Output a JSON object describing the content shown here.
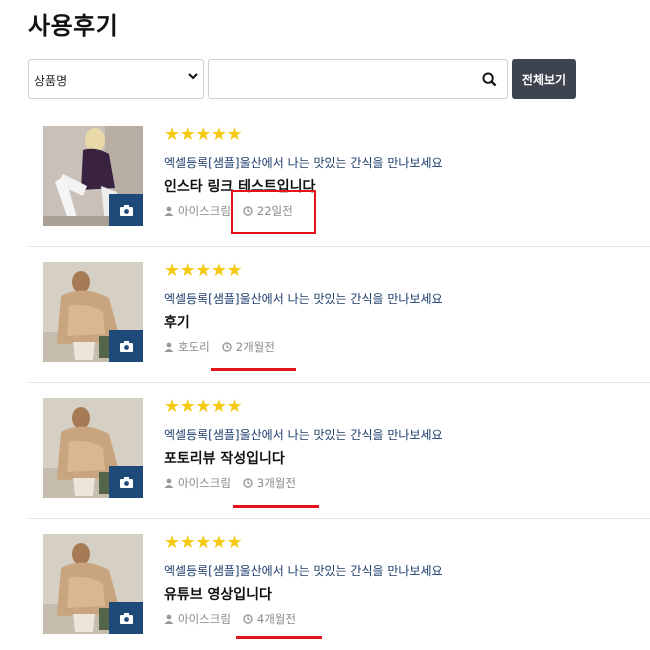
{
  "page": {
    "title": "사용후기"
  },
  "search": {
    "select_value": "상품명",
    "input_value": "",
    "view_all_label": "전체보기"
  },
  "colors": {
    "star": "#f6c915",
    "camera_badge": "#1d4a78",
    "button": "#3d4450",
    "annotation": "#e4141b"
  },
  "reviews": [
    {
      "rating": 5,
      "stars": "★★★★★",
      "product": "엑셀등록[샘플]울산에서 나는 맛있는 간식을 만나보세요",
      "title": "인스타 링크 테스트입니다",
      "author": "아이스크림",
      "date": "22일전",
      "photo": "model-white-boots"
    },
    {
      "rating": 5,
      "stars": "★★★★★",
      "product": "엑셀등록[샘플]울산에서 나는 맛있는 간식을 만나보세요",
      "title": "후기",
      "author": "호도리",
      "date": "2개월전",
      "photo": "model-fur-coat"
    },
    {
      "rating": 5,
      "stars": "★★★★★",
      "product": "엑셀등록[샘플]울산에서 나는 맛있는 간식을 만나보세요",
      "title": "포토리뷰 작성입니다",
      "author": "아이스크림",
      "date": "3개월전",
      "photo": "model-fur-coat"
    },
    {
      "rating": 5,
      "stars": "★★★★★",
      "product": "엑셀등록[샘플]울산에서 나는 맛있는 간식을 만나보세요",
      "title": "유튜브 영상입니다",
      "author": "아이스크림",
      "date": "4개월전",
      "photo": "model-fur-coat"
    }
  ]
}
